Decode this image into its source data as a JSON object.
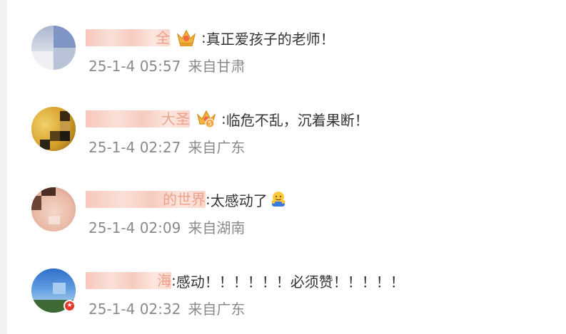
{
  "comments": [
    {
      "username_tail": "全",
      "text": "真正爱孩子的老师！",
      "timestamp": "25-1-4 05:57",
      "location": "来自甘肃",
      "badge_icon": "crown-badge-icon"
    },
    {
      "username_tail": "大圣",
      "text": "临危不乱，沉着果断！",
      "timestamp": "25-1-4 02:27",
      "location": "来自广东",
      "badge_icon": "crown-level-5-icon",
      "badge_level": "5"
    },
    {
      "username_tail": "的世界",
      "text": "太感动了",
      "timestamp": "25-1-4 02:09",
      "location": "来自湖南",
      "emoji": "hug-emoji-icon"
    },
    {
      "username_tail": "海",
      "text": "感动！！！！！！必须赞！！！！！",
      "timestamp": "25-1-4 02:32",
      "location": "来自广东",
      "avatar_badge": "verified-badge-icon",
      "avatar_badge_glyph": "★"
    }
  ],
  "separator": ":",
  "colors": {
    "username": "#e0704c",
    "text": "#333333",
    "meta": "#8a8a8a",
    "crown_gold": "#f2b43b",
    "badge_red": "#e8382b"
  }
}
